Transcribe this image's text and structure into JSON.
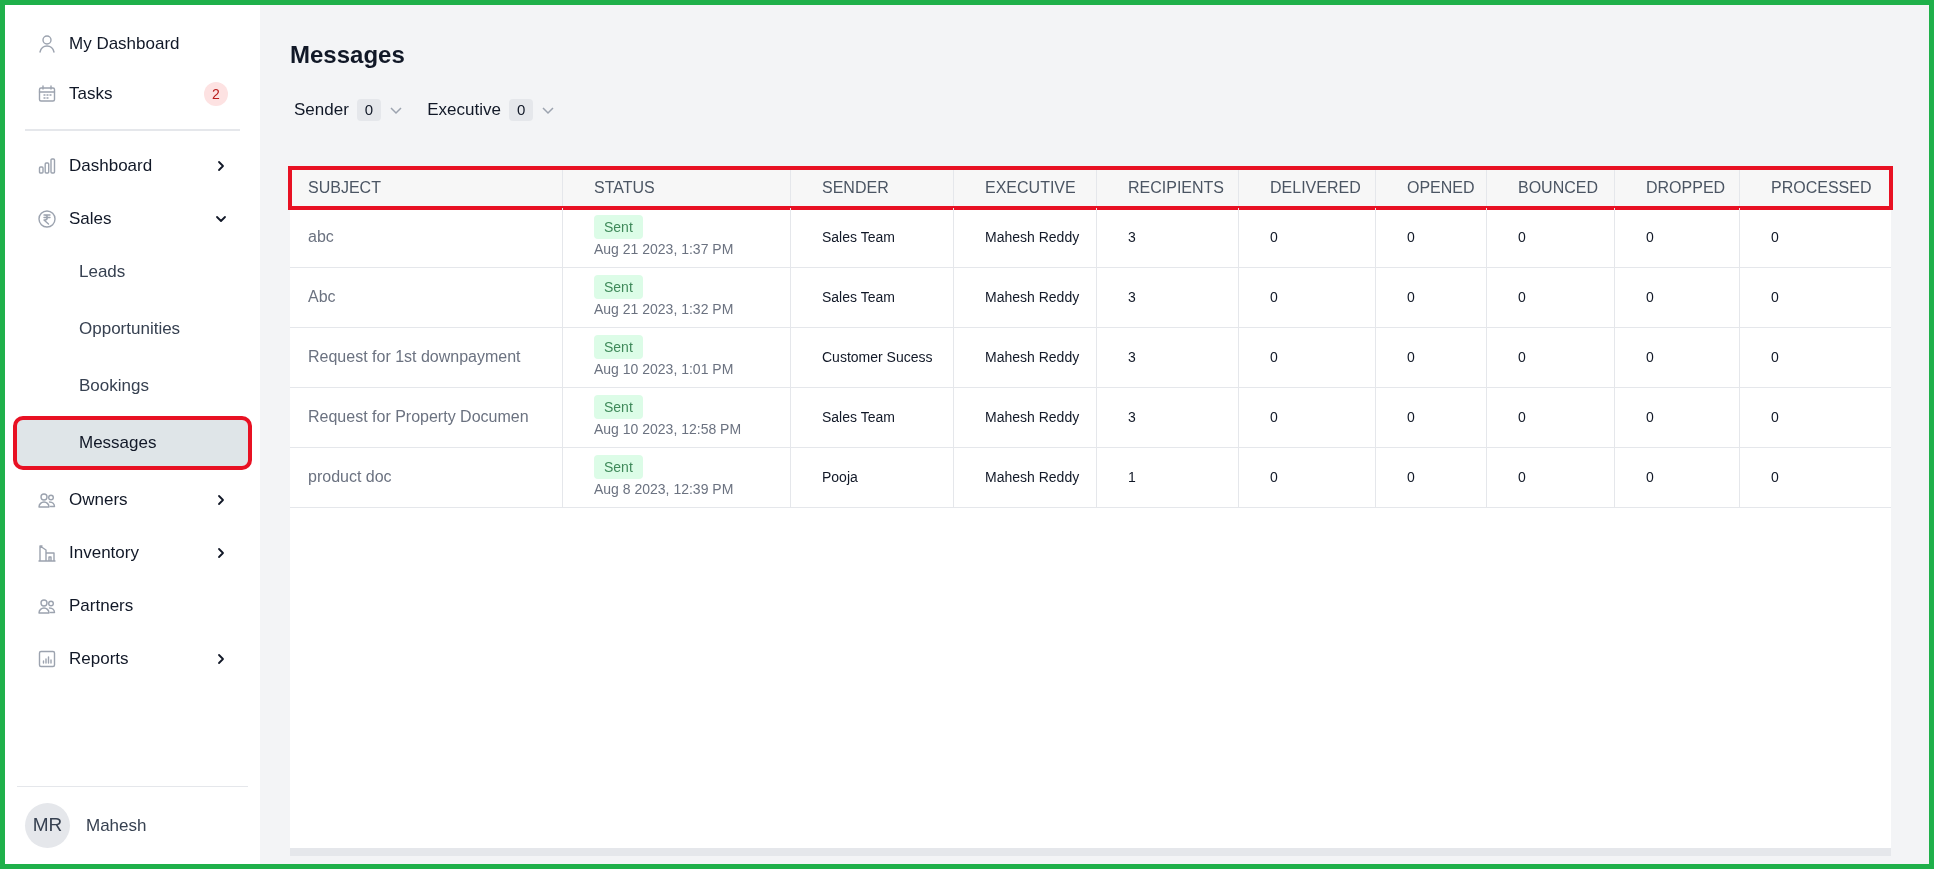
{
  "sidebar": {
    "top_items": [
      {
        "label": "My Dashboard"
      },
      {
        "label": "Tasks",
        "badge": "2"
      }
    ],
    "nav": [
      {
        "label": "Dashboard",
        "kind": "group",
        "expanded": false
      },
      {
        "label": "Sales",
        "kind": "group",
        "expanded": true,
        "children": [
          {
            "label": "Leads",
            "selected": false,
            "annotated": false
          },
          {
            "label": "Opportunities",
            "selected": false,
            "annotated": false
          },
          {
            "label": "Bookings",
            "selected": false,
            "annotated": false
          },
          {
            "label": "Messages",
            "selected": true,
            "annotated": true
          }
        ]
      },
      {
        "label": "Owners",
        "kind": "group",
        "expanded": false
      },
      {
        "label": "Inventory",
        "kind": "group",
        "expanded": false
      },
      {
        "label": "Partners",
        "kind": "link"
      },
      {
        "label": "Reports",
        "kind": "group",
        "expanded": false
      }
    ],
    "user": {
      "initials": "MR",
      "name": "Mahesh"
    }
  },
  "page": {
    "title": "Messages",
    "filters": [
      {
        "label": "Sender",
        "count": "0"
      },
      {
        "label": "Executive",
        "count": "0"
      }
    ]
  },
  "table": {
    "header_annotated": true,
    "columns": [
      "SUBJECT",
      "STATUS",
      "SENDER",
      "EXECUTIVE",
      "RECIPIENTS",
      "DELIVERED",
      "OPENED",
      "BOUNCED",
      "DROPPED",
      "PROCESSED"
    ],
    "rows": [
      {
        "cells": [
          "abc",
          {
            "kind": "sent",
            "label": "Sent",
            "time": "Aug 21 2023, 1:37 PM"
          },
          "Sales Team",
          "Mahesh Reddy",
          "3",
          "0",
          "0",
          "0",
          "0",
          "0"
        ]
      },
      {
        "cells": [
          "Abc",
          {
            "kind": "sent",
            "label": "Sent",
            "time": "Aug 21 2023, 1:32 PM"
          },
          "Sales Team",
          "Mahesh Reddy",
          "3",
          "0",
          "0",
          "0",
          "0",
          "0"
        ]
      },
      {
        "cells": [
          "Request for 1st downpayment",
          {
            "kind": "sent",
            "label": "Sent",
            "time": "Aug 10 2023, 1:01 PM"
          },
          "Customer Sucess",
          "Mahesh Reddy",
          "3",
          "0",
          "0",
          "0",
          "0",
          "0"
        ]
      },
      {
        "cells": [
          "Request for Property Documen",
          {
            "kind": "sent",
            "label": "Sent",
            "time": "Aug 10 2023, 12:58 PM"
          },
          "Sales Team",
          "Mahesh Reddy",
          "3",
          "0",
          "0",
          "0",
          "0",
          "0"
        ]
      },
      {
        "cells": [
          "product doc",
          {
            "kind": "sent",
            "label": "Sent",
            "time": "Aug 8 2023, 12:39 PM"
          },
          "Pooja",
          "Mahesh Reddy",
          "1",
          "0",
          "0",
          "0",
          "0",
          "0"
        ]
      }
    ]
  }
}
